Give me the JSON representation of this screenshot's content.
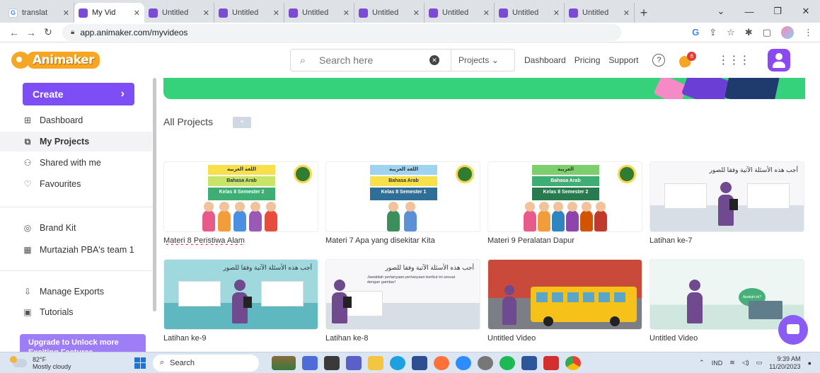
{
  "browser": {
    "tabs": [
      {
        "label": "translat",
        "icon": "google-icon",
        "active": false
      },
      {
        "label": "My Vid",
        "icon": "animaker-icon",
        "active": true
      },
      {
        "label": "Untitled",
        "icon": "animaker-icon",
        "active": false
      },
      {
        "label": "Untitled",
        "icon": "animaker-icon",
        "active": false
      },
      {
        "label": "Untitled",
        "icon": "animaker-icon",
        "active": false
      },
      {
        "label": "Untitled",
        "icon": "animaker-icon",
        "active": false
      },
      {
        "label": "Untitled",
        "icon": "animaker-icon",
        "active": false
      },
      {
        "label": "Untitled",
        "icon": "animaker-icon",
        "active": false
      },
      {
        "label": "Untitled",
        "icon": "animaker-icon",
        "active": false
      }
    ],
    "url": "app.animaker.com/myvideos"
  },
  "header": {
    "logo_text": "Animaker",
    "search_placeholder": "Search here",
    "search_scope": "Projects",
    "nav": [
      "Dashboard",
      "Pricing",
      "Support"
    ],
    "notification_count": "6"
  },
  "sidebar": {
    "create_label": "Create",
    "items": [
      {
        "label": "Dashboard",
        "icon": "grid-icon",
        "active": false
      },
      {
        "label": "My Projects",
        "icon": "projects-icon",
        "active": true
      },
      {
        "label": "Shared with me",
        "icon": "shared-user-icon",
        "active": false
      },
      {
        "label": "Favourites",
        "icon": "heart-icon",
        "active": false
      },
      {
        "label": "Brand Kit",
        "icon": "brand-kit-icon",
        "active": false
      },
      {
        "label": "Murtaziah PBA's team 1",
        "icon": "team-icon",
        "active": false
      },
      {
        "label": "Manage Exports",
        "icon": "export-icon",
        "active": false
      },
      {
        "label": "Tutorials",
        "icon": "tutorials-icon",
        "active": false
      }
    ],
    "upgrade_label": "Upgrade to Unlock more Exciting Features"
  },
  "main": {
    "section_title": "All Projects",
    "projects": [
      {
        "title": "Materi 8 Peristiwa Alam",
        "thumb": "arabic"
      },
      {
        "title": "Materi 7 Apa yang disekitar Kita",
        "thumb": "arabic"
      },
      {
        "title": "Materi 9 Peralatan Dapur",
        "thumb": "arabic"
      },
      {
        "title": "Latihan ke-7",
        "thumb": "class"
      },
      {
        "title": "Latihan ke-9",
        "thumb": "class-teal"
      },
      {
        "title": "Latihan ke-8",
        "thumb": "class"
      },
      {
        "title": "Untitled Video",
        "thumb": "bus"
      },
      {
        "title": "Untitled Video",
        "thumb": "class-mint"
      }
    ],
    "thumb_texts": {
      "card1_l1": "اللغة العربية",
      "card1_l2": "Bahasa Arab",
      "card1_l3": "Kelas 8 Semester 2",
      "card2_l1": "اللغة العربية",
      "card2_l2": "Bahasa Arab",
      "card2_l3": "Kelas 8 Semester 1",
      "card3_l1": "العربية",
      "card3_l2": "Bahasa Arab",
      "card3_l3": "Kelas 8 Semester 2",
      "arabic_instruction": "أجب هذه الأسئلة الآتية وفقا للصور",
      "indo_instruction": "Jawablah pertanyaan-pertanyaan berikut ini sesuai dengan gambar!",
      "bubble": "Apakah ini?"
    }
  },
  "taskbar": {
    "weather_temp": "82°F",
    "weather_desc": "Mostly cloudy",
    "search_label": "Search",
    "lang": "IND",
    "time": "9:39 AM",
    "date": "11/20/2023"
  }
}
